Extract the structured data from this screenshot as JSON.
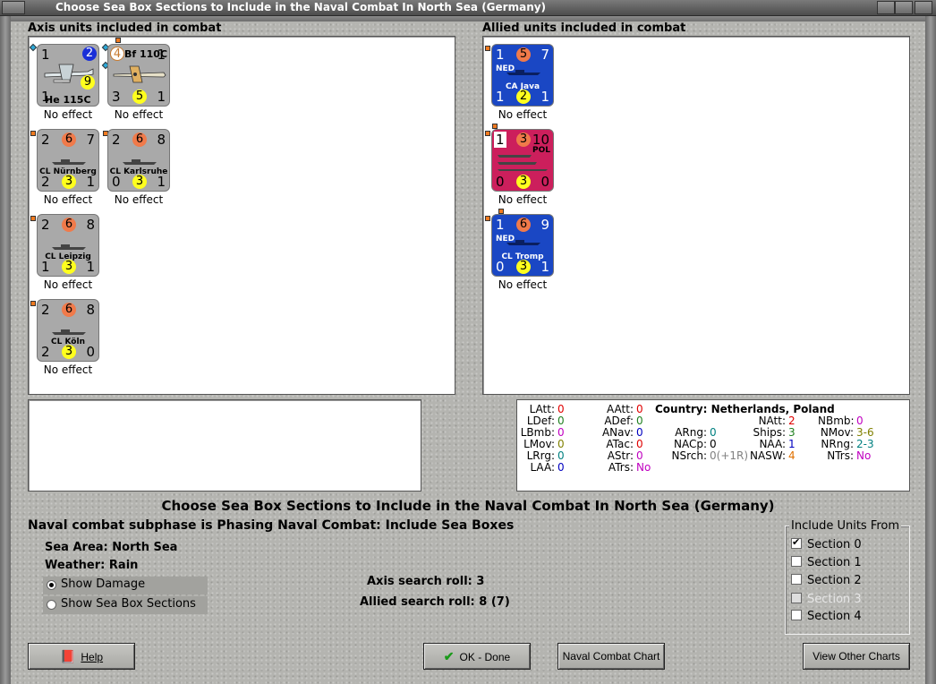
{
  "window": {
    "title": "Choose Sea Box Sections to Include in the Naval Combat In North Sea (Germany)"
  },
  "axis": {
    "label": "Axis units included in combat",
    "units": [
      {
        "name": "He 115C",
        "tl": "1",
        "tm": "2",
        "bm": "9",
        "bl": "1",
        "br": "",
        "result": "No effect"
      },
      {
        "name": "Bf 110C",
        "tl": "4",
        "tr": "1",
        "bl": "3",
        "bm": "5",
        "br": "1",
        "result": "No effect"
      },
      {
        "name": "CL Nürnberg",
        "tl": "2",
        "tm": "6",
        "tr": "7",
        "bl": "2",
        "bm": "3",
        "br": "1",
        "result": "No effect"
      },
      {
        "name": "CL Karlsruhe",
        "tl": "2",
        "tm": "6",
        "tr": "8",
        "bl": "0",
        "bm": "3",
        "br": "1",
        "result": "No effect"
      },
      {
        "name": "CL Leipzig",
        "tl": "2",
        "tm": "6",
        "tr": "8",
        "bl": "1",
        "bm": "3",
        "br": "1",
        "result": "No effect"
      },
      {
        "name": "CL Köln",
        "tl": "2",
        "tm": "6",
        "tr": "8",
        "bl": "2",
        "bm": "3",
        "br": "0",
        "result": "No effect"
      }
    ]
  },
  "allied": {
    "label": "Allied units included in combat",
    "units": [
      {
        "name": "CA Java",
        "nat": "NED",
        "tl": "1",
        "tm": "5",
        "tr": "7",
        "bl": "1",
        "bm": "2",
        "br": "1",
        "result": "No effect"
      },
      {
        "name": "",
        "nat": "POL",
        "tl": "1",
        "tm": "3",
        "tr": "10",
        "bl": "0",
        "bm": "3",
        "br": "0",
        "result": "No effect"
      },
      {
        "name": "CL Tromp",
        "nat": "NED",
        "tl": "1",
        "tm": "6",
        "tr": "9",
        "bl": "0",
        "bm": "3",
        "br": "1",
        "result": "No effect"
      }
    ]
  },
  "stats": {
    "country_label": "Country:",
    "country_value": "Netherlands, Poland",
    "col1": [
      {
        "k": "LAtt:",
        "v": "0",
        "c": "#e00000"
      },
      {
        "k": "LDef:",
        "v": "0",
        "c": "#208020"
      },
      {
        "k": "LBmb:",
        "v": "0",
        "c": "#c000c0"
      },
      {
        "k": "LMov:",
        "v": "0",
        "c": "#808000"
      },
      {
        "k": "LRrg:",
        "v": "0",
        "c": "#008080"
      },
      {
        "k": "LAA:",
        "v": "0",
        "c": "#0000c0"
      }
    ],
    "col2": [
      {
        "k": "AAtt:",
        "v": "0",
        "c": "#e00000"
      },
      {
        "k": "ADef:",
        "v": "0",
        "c": "#208020"
      },
      {
        "k": "ANav:",
        "v": "0",
        "c": "#0000c0"
      },
      {
        "k": "ATac:",
        "v": "0",
        "c": "#e00000"
      },
      {
        "k": "AStr:",
        "v": "0",
        "c": "#c000c0"
      },
      {
        "k": "ATrs:",
        "v": "No",
        "c": "#c000c0"
      }
    ],
    "col3": [
      {
        "k": "ARng:",
        "v": "0",
        "c": "#008080"
      },
      {
        "k": "NACp:",
        "v": "0",
        "c": "#000000"
      },
      {
        "k": "NSrch:",
        "v": "0(+1R)",
        "c": "#808080"
      }
    ],
    "col4": [
      {
        "k": "NAtt:",
        "v": "2",
        "c": "#e00000"
      },
      {
        "k": "Ships:",
        "v": "3",
        "c": "#208020"
      },
      {
        "k": "NAA:",
        "v": "1",
        "c": "#0000c0"
      },
      {
        "k": "NASW:",
        "v": "4",
        "c": "#e07000"
      }
    ],
    "col5": [
      {
        "k": "NBmb:",
        "v": "0",
        "c": "#c000c0"
      },
      {
        "k": "NMov:",
        "v": "3-6",
        "c": "#808000"
      },
      {
        "k": "NRng:",
        "v": "2-3",
        "c": "#008080"
      },
      {
        "k": "NTrs:",
        "v": "No",
        "c": "#c000c0"
      }
    ]
  },
  "main": {
    "heading": "Choose Sea Box Sections to Include in the Naval Combat In North Sea (Germany)",
    "subphase": "Naval combat subphase is Phasing Naval Combat: Include Sea Boxes",
    "sea_area_label": "Sea Area:",
    "sea_area_value": "North Sea",
    "weather_label": "Weather:",
    "weather_value": "Rain",
    "show_damage": "Show Damage",
    "show_sections": "Show Sea Box Sections",
    "axis_roll_label": "Axis search roll:",
    "axis_roll_value": "3",
    "allied_roll_label": "Allied search roll:",
    "allied_roll_value": "8 (7)"
  },
  "include": {
    "title": "Include Units From",
    "sections": [
      {
        "label": "Section 0",
        "checked": true,
        "disabled": false
      },
      {
        "label": "Section 1",
        "checked": false,
        "disabled": false
      },
      {
        "label": "Section 2",
        "checked": false,
        "disabled": false
      },
      {
        "label": "Section 3",
        "checked": false,
        "disabled": true
      },
      {
        "label": "Section 4",
        "checked": false,
        "disabled": false
      }
    ]
  },
  "buttons": {
    "help": "Help",
    "ok": "OK - Done",
    "naval_chart": "Naval Combat Chart",
    "other_charts": "View Other Charts"
  }
}
